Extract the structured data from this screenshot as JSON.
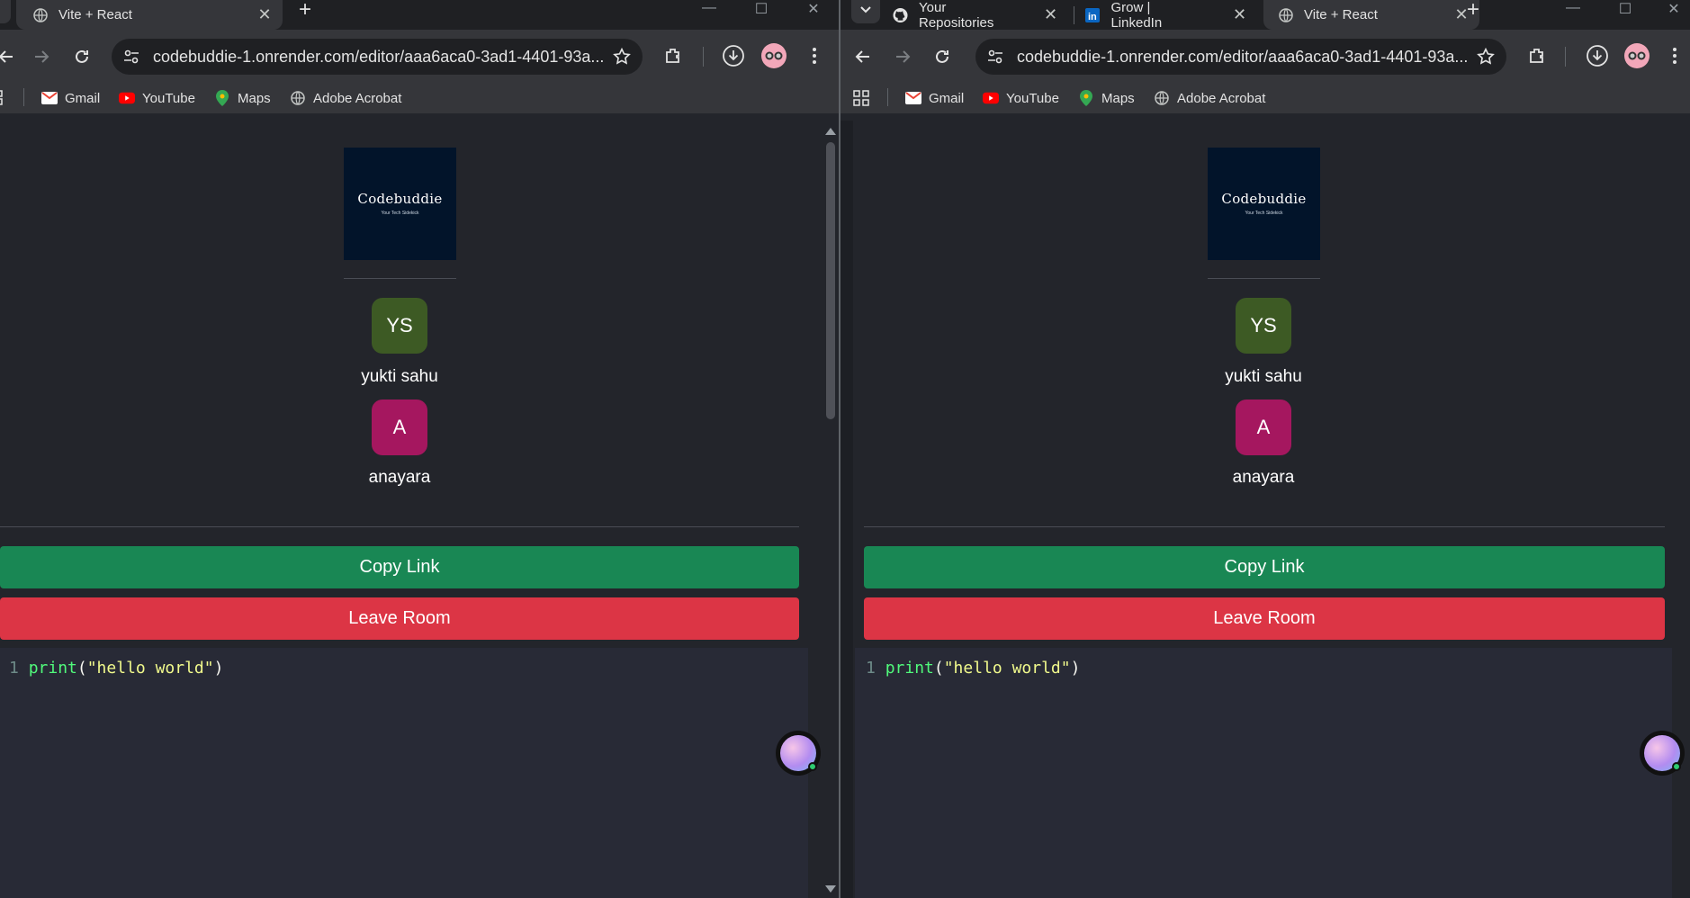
{
  "colors": {
    "copy_button": "#198754",
    "leave_button": "#dc3545",
    "avatar_ys": "#3d5a24",
    "avatar_a": "#a5175f",
    "logo_bg": "#02142a",
    "editor_bg": "#282a36"
  },
  "left_window": {
    "tabs": [
      {
        "title": "Vite + React",
        "icon": "globe-icon",
        "active": true
      }
    ],
    "url": "codebuddie-1.onrender.com/editor/aaa6aca0-3ad1-4401-93a...",
    "bookmarks": [
      {
        "label": "Gmail",
        "icon": "gmail-icon"
      },
      {
        "label": "YouTube",
        "icon": "youtube-icon"
      },
      {
        "label": "Maps",
        "icon": "maps-icon"
      },
      {
        "label": "Adobe Acrobat",
        "icon": "globe-icon"
      }
    ]
  },
  "right_window": {
    "tabs": [
      {
        "title": "Your Repositories",
        "icon": "github-icon",
        "active": false
      },
      {
        "title": "Grow | LinkedIn",
        "icon": "linkedin-icon",
        "active": false
      },
      {
        "title": "Vite + React",
        "icon": "globe-icon",
        "active": true
      }
    ],
    "url": "codebuddie-1.onrender.com/editor/aaa6aca0-3ad1-4401-93a...",
    "bookmarks": [
      {
        "label": "Gmail",
        "icon": "gmail-icon"
      },
      {
        "label": "YouTube",
        "icon": "youtube-icon"
      },
      {
        "label": "Maps",
        "icon": "maps-icon"
      },
      {
        "label": "Adobe Acrobat",
        "icon": "globe-icon"
      }
    ]
  },
  "app": {
    "logo_title": "Codebuddie",
    "logo_tagline": "Your Tech Sidekick",
    "users": [
      {
        "initials": "YS",
        "name": "yukti sahu"
      },
      {
        "initials": "A",
        "name": "anayara"
      }
    ],
    "copy_label": "Copy Link",
    "leave_label": "Leave Room",
    "code": {
      "line_number": "1",
      "fn": "print",
      "open": "(",
      "str": "\"hello world\"",
      "close": ")"
    }
  }
}
